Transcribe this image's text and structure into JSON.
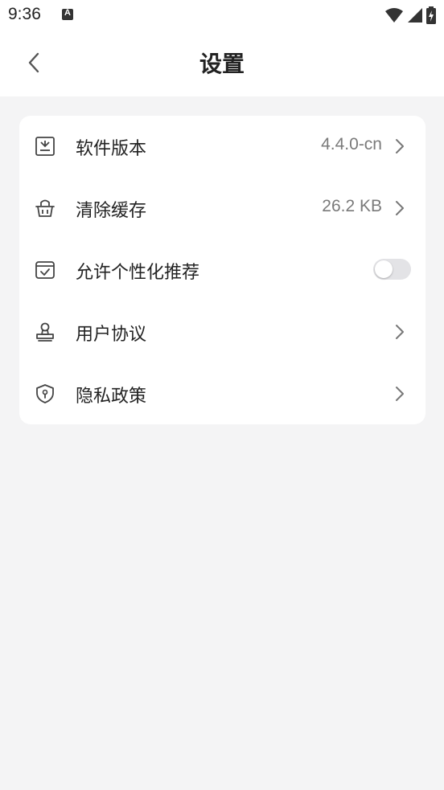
{
  "status_bar": {
    "time": "9:36",
    "notification_letter": "A",
    "icons": [
      "wifi-icon",
      "signal-icon",
      "battery-charging-icon"
    ]
  },
  "header": {
    "title": "设置",
    "back_icon": "chevron-left-icon"
  },
  "settings": [
    {
      "label": "软件版本",
      "value": "4.4.0-cn",
      "icon": "download-box-icon",
      "control": "chevron"
    },
    {
      "label": "清除缓存",
      "value": "26.2 KB",
      "icon": "basket-icon",
      "control": "chevron"
    },
    {
      "label": "允许个性化推荐",
      "value": "",
      "icon": "check-box-icon",
      "control": "toggle",
      "toggle_on": false
    },
    {
      "label": "用户协议",
      "value": "",
      "icon": "stamp-icon",
      "control": "chevron"
    },
    {
      "label": "隐私政策",
      "value": "",
      "icon": "shield-icon",
      "control": "chevron"
    }
  ],
  "colors": {
    "background": "#f4f4f5",
    "card": "#ffffff",
    "text": "#222222",
    "secondary_text": "#7a7a7a",
    "toggle_off": "#e3e3e6"
  }
}
